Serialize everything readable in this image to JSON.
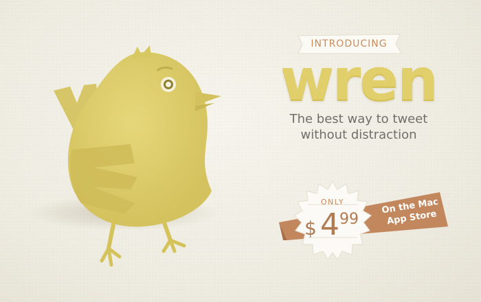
{
  "promo": {
    "intro_label": "INTRODUCING",
    "app_name": "wren",
    "tagline_line1": "The best way to tweet",
    "tagline_line2": "without distraction",
    "price_prefix": "ONLY",
    "price_currency": "$",
    "price_whole": "4",
    "price_cents": "99",
    "store_line1": "On the Mac",
    "store_line2": "App Store"
  },
  "icons": {
    "mascot": "wren-bird-illustration"
  },
  "colors": {
    "background": "#efece2",
    "bird_yellow": "#dccd6c",
    "wordmark": "#e0cf6b",
    "ribbon_brown": "#c3875d",
    "tagline_gray": "#6f6f68",
    "price_brown": "#b27a50"
  }
}
